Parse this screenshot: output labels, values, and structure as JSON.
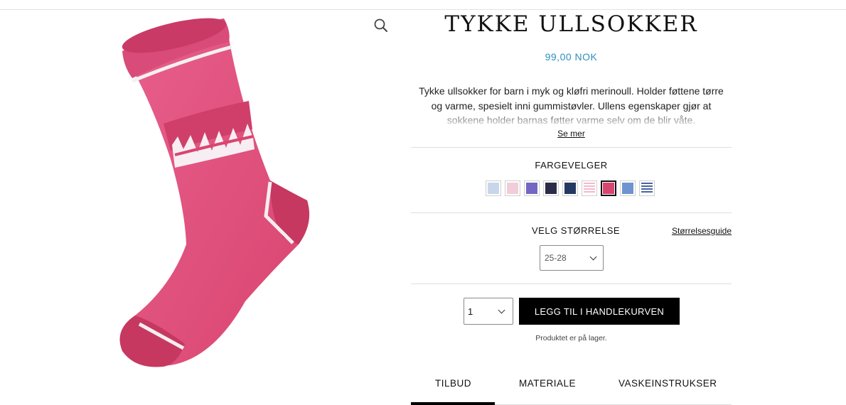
{
  "product": {
    "title": "TYKKE ULLSOKKER",
    "price": "99,00 NOK",
    "description": "Tykke ullsokker for barn i myk og kløfri merinoull. Holder føttene tørre og varme, spesielt inni gummistøvler. Ullens egenskaper gjør at sokkene holder barnas føtter varme selv om de blir våte.",
    "see_more": "Se mer",
    "image_icon": "pink-wool-sock-image",
    "zoom_icon": "magnifier-icon"
  },
  "color_picker": {
    "label": "FARGEVELGER",
    "swatches": [
      {
        "name": "light-blue",
        "color": "#c7d6ea"
      },
      {
        "name": "light-pink",
        "color": "#f1cdd9"
      },
      {
        "name": "purple",
        "color": "#7467c4"
      },
      {
        "name": "dark-navy",
        "color": "#2b2d48"
      },
      {
        "name": "navy",
        "color": "#253a63"
      },
      {
        "name": "pink-stripe",
        "color": "#f3b9cc"
      },
      {
        "name": "pink",
        "color": "#d8456f",
        "selected": true
      },
      {
        "name": "blue",
        "color": "#6f93cf"
      },
      {
        "name": "blue-stripe",
        "color": "#4a64a3"
      }
    ]
  },
  "size": {
    "label": "VELG STØRRELSE",
    "guide_link": "Størrelsesguide",
    "selected": "25-28"
  },
  "cart": {
    "quantity": "1",
    "button_label": "LEGG TIL I HANDLEKURVEN",
    "stock_text": "Produktet er på lager."
  },
  "tabs": [
    {
      "label": "TILBUD",
      "active": true
    },
    {
      "label": "MATERIALE",
      "active": false
    },
    {
      "label": "VASKEINSTRUKSER",
      "active": false
    }
  ]
}
